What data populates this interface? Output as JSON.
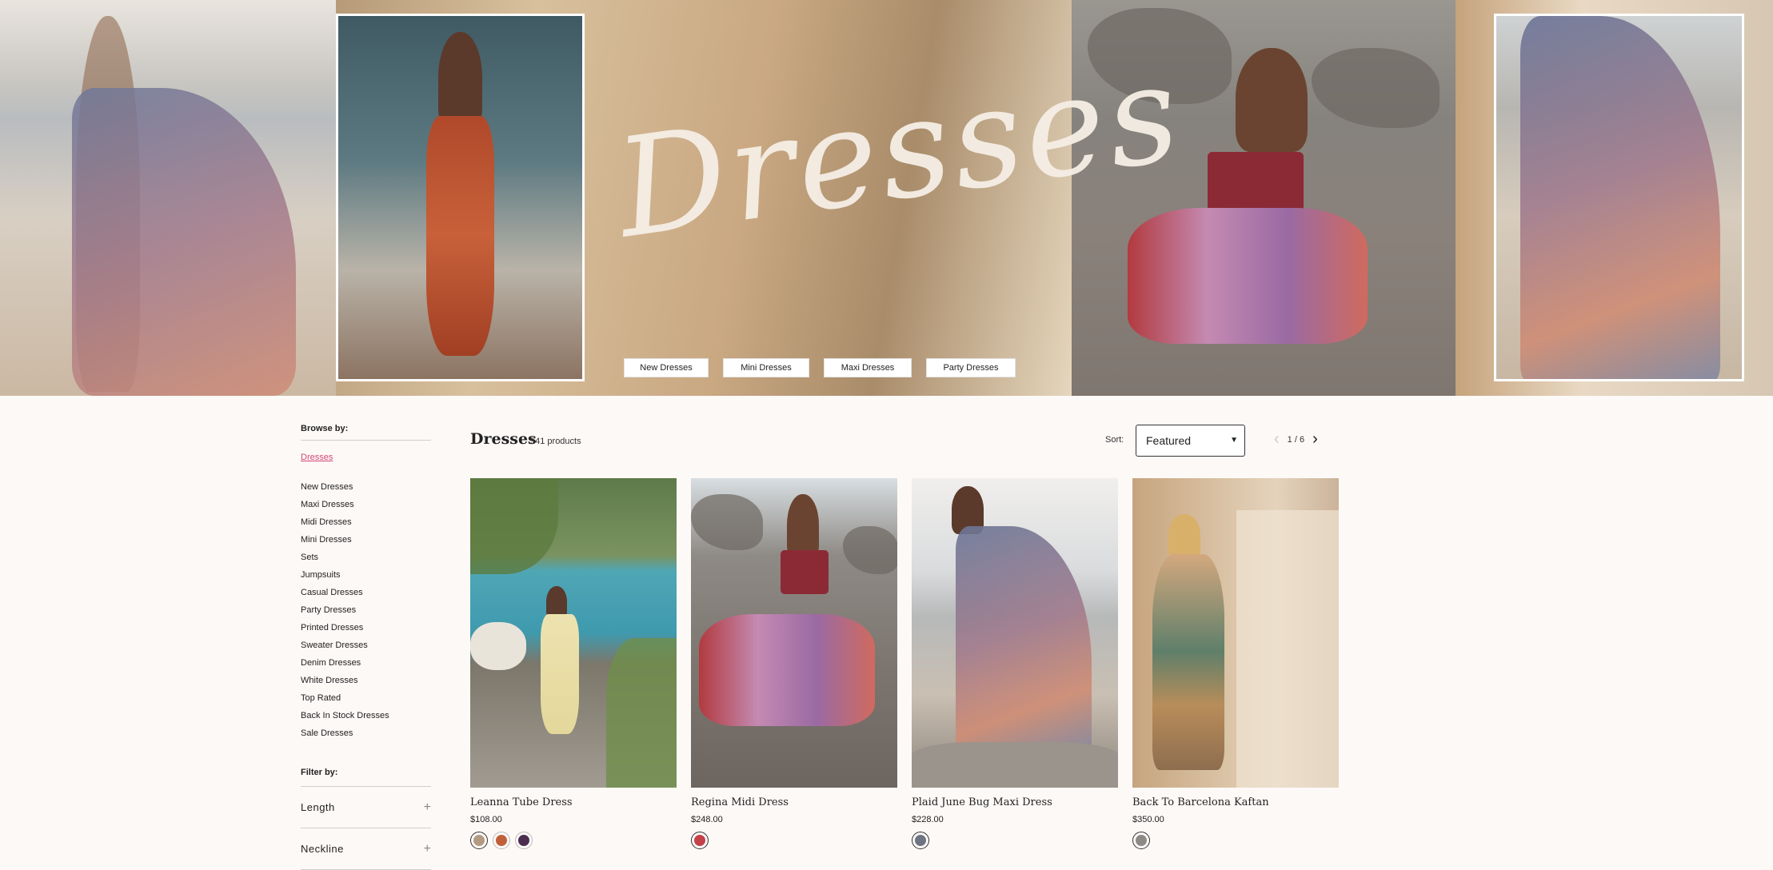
{
  "hero": {
    "title": "Dresses",
    "buttons": [
      "New Dresses",
      "Mini Dresses",
      "Maxi Dresses",
      "Party Dresses"
    ]
  },
  "sidebar": {
    "browse_heading": "Browse by:",
    "active_item": "Dresses",
    "items": [
      "New Dresses",
      "Maxi Dresses",
      "Midi Dresses",
      "Mini Dresses",
      "Sets",
      "Jumpsuits",
      "Casual Dresses",
      "Party Dresses",
      "Printed Dresses",
      "Sweater Dresses",
      "Denim Dresses",
      "White Dresses",
      "Top Rated",
      "Back In Stock Dresses",
      "Sale Dresses"
    ],
    "filter_heading": "Filter by:",
    "filters": [
      "Length",
      "Neckline"
    ]
  },
  "main": {
    "title": "Dresses",
    "count": "541 products",
    "sort_label": "Sort:",
    "sort_value": "Featured",
    "page_indicator": "1 / 6"
  },
  "products": [
    {
      "name": "Leanna Tube Dress",
      "price": "$108.00",
      "swatches": [
        "#b39a82",
        "#c0603a",
        "#4a2d4f"
      ]
    },
    {
      "name": "Regina Midi Dress",
      "price": "$248.00",
      "swatches": [
        "#c4414a"
      ]
    },
    {
      "name": "Plaid June Bug Maxi Dress",
      "price": "$228.00",
      "swatches": [
        "#6e7482"
      ]
    },
    {
      "name": "Back To Barcelona Kaftan",
      "price": "$350.00",
      "swatches": [
        "#8d8a85"
      ]
    }
  ],
  "colors": {
    "accent_link": "#d4477a",
    "background": "#fdf9f7"
  }
}
